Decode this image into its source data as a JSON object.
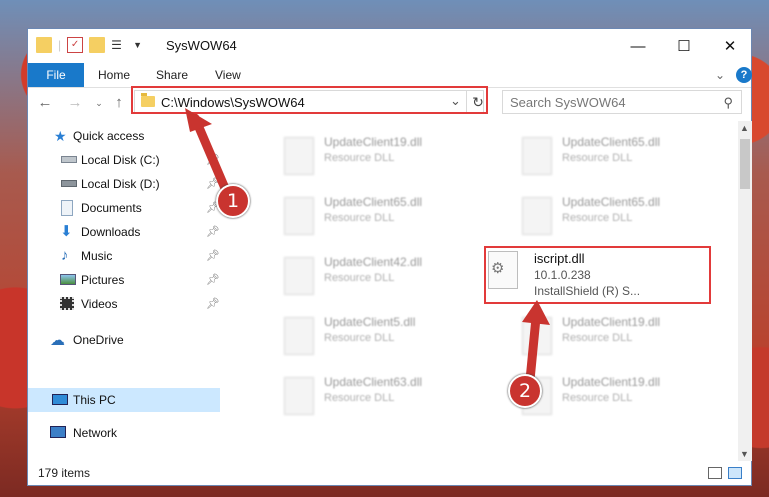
{
  "window": {
    "title": "SysWOW64",
    "minimize": "—",
    "maximize": "☐",
    "close": "✕"
  },
  "ribbon": {
    "tabs": [
      "File",
      "Home",
      "Share",
      "View"
    ],
    "expand": "⌄",
    "help": "?"
  },
  "address": {
    "path": "C:\\Windows\\SysWOW64",
    "dropdown": "⌄",
    "refresh": "↻"
  },
  "search": {
    "placeholder": "Search SysWOW64",
    "icon": "magnifier-icon"
  },
  "nav": {
    "quick_access": "Quick access",
    "items": [
      {
        "label": "Local Disk (C:)"
      },
      {
        "label": "Local Disk (D:)"
      },
      {
        "label": "Documents"
      },
      {
        "label": "Downloads"
      },
      {
        "label": "Music"
      },
      {
        "label": "Pictures"
      },
      {
        "label": "Videos"
      }
    ],
    "onedrive": "OneDrive",
    "this_pc": "This PC",
    "network": "Network"
  },
  "files": [
    {
      "name": "UpdateClient19.dll",
      "desc": "Resource DLL"
    },
    {
      "name": "UpdateClient65.dll",
      "desc": "Resource DLL"
    },
    {
      "name": "UpdateClient65.dll",
      "desc": "Resource DLL"
    },
    {
      "name": "UpdateClient65.dll",
      "desc": "Resource DLL"
    },
    {
      "name": "UpdateClient42.dll",
      "desc": "Resource DLL"
    },
    {
      "name": "UpdateClient5.dll",
      "desc": "Resource DLL"
    },
    {
      "name": "UpdateClient19.dll",
      "desc": "Resource DLL"
    },
    {
      "name": "UpdateClient63.dll",
      "desc": "Resource DLL"
    },
    {
      "name": "UpdateClient19.dll",
      "desc": "Resource DLL"
    }
  ],
  "highlighted_file": {
    "name": "iscript.dll",
    "version": "10.1.0.238",
    "desc": "InstallShield (R) S..."
  },
  "status": {
    "count": "179 items"
  },
  "annotations": {
    "step1": "1",
    "step2": "2",
    "highlight_color": "#e23a3a"
  }
}
